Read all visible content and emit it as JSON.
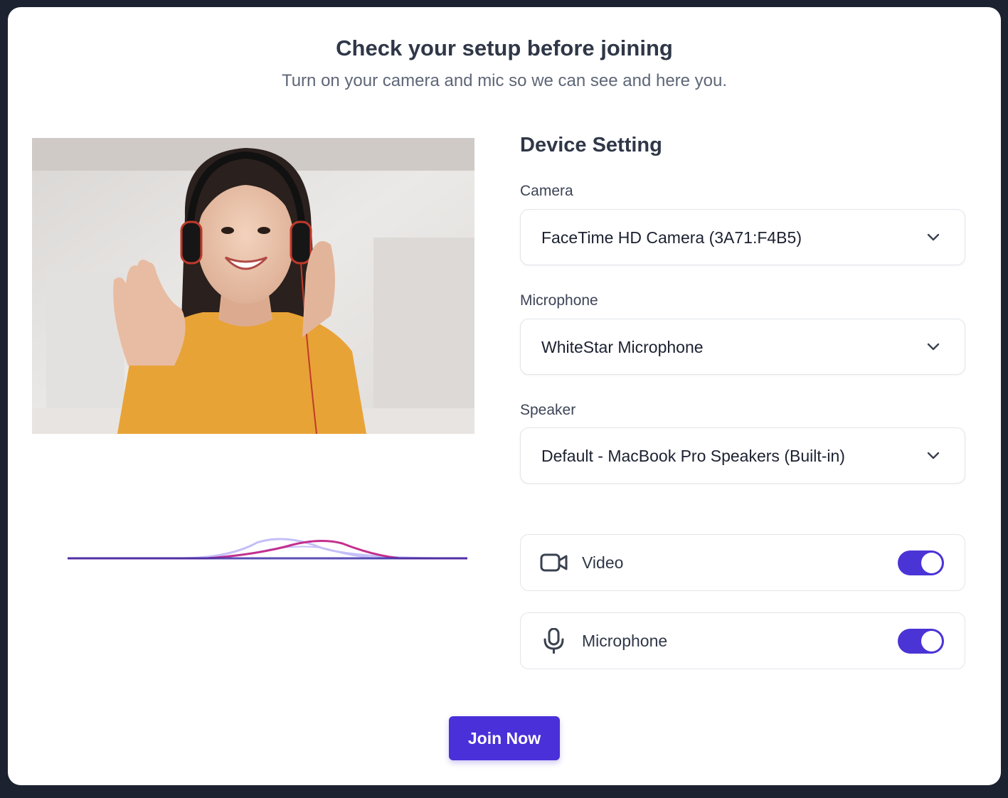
{
  "header": {
    "title": "Check your setup before joining",
    "subtitle": "Turn on your camera and mic so we can see and here you."
  },
  "preview": {
    "image": "woman-waving-with-headphones"
  },
  "settings": {
    "title": "Device Setting",
    "camera": {
      "label": "Camera",
      "value": "FaceTime HD Camera (3A71:F4B5)"
    },
    "microphone": {
      "label": "Microphone",
      "value": "WhiteStar Microphone"
    },
    "speaker": {
      "label": "Speaker",
      "value": "Default - MacBook Pro Speakers (Built-in)"
    }
  },
  "toggles": {
    "video": {
      "label": "Video",
      "icon": "video-camera-icon",
      "on": true
    },
    "microphone": {
      "label": "Microphone",
      "icon": "microphone-icon",
      "on": true
    }
  },
  "actions": {
    "join_label": "Join Now"
  },
  "colors": {
    "accent": "#4a30d8",
    "title": "#2f3747",
    "background": "#1c2230"
  }
}
